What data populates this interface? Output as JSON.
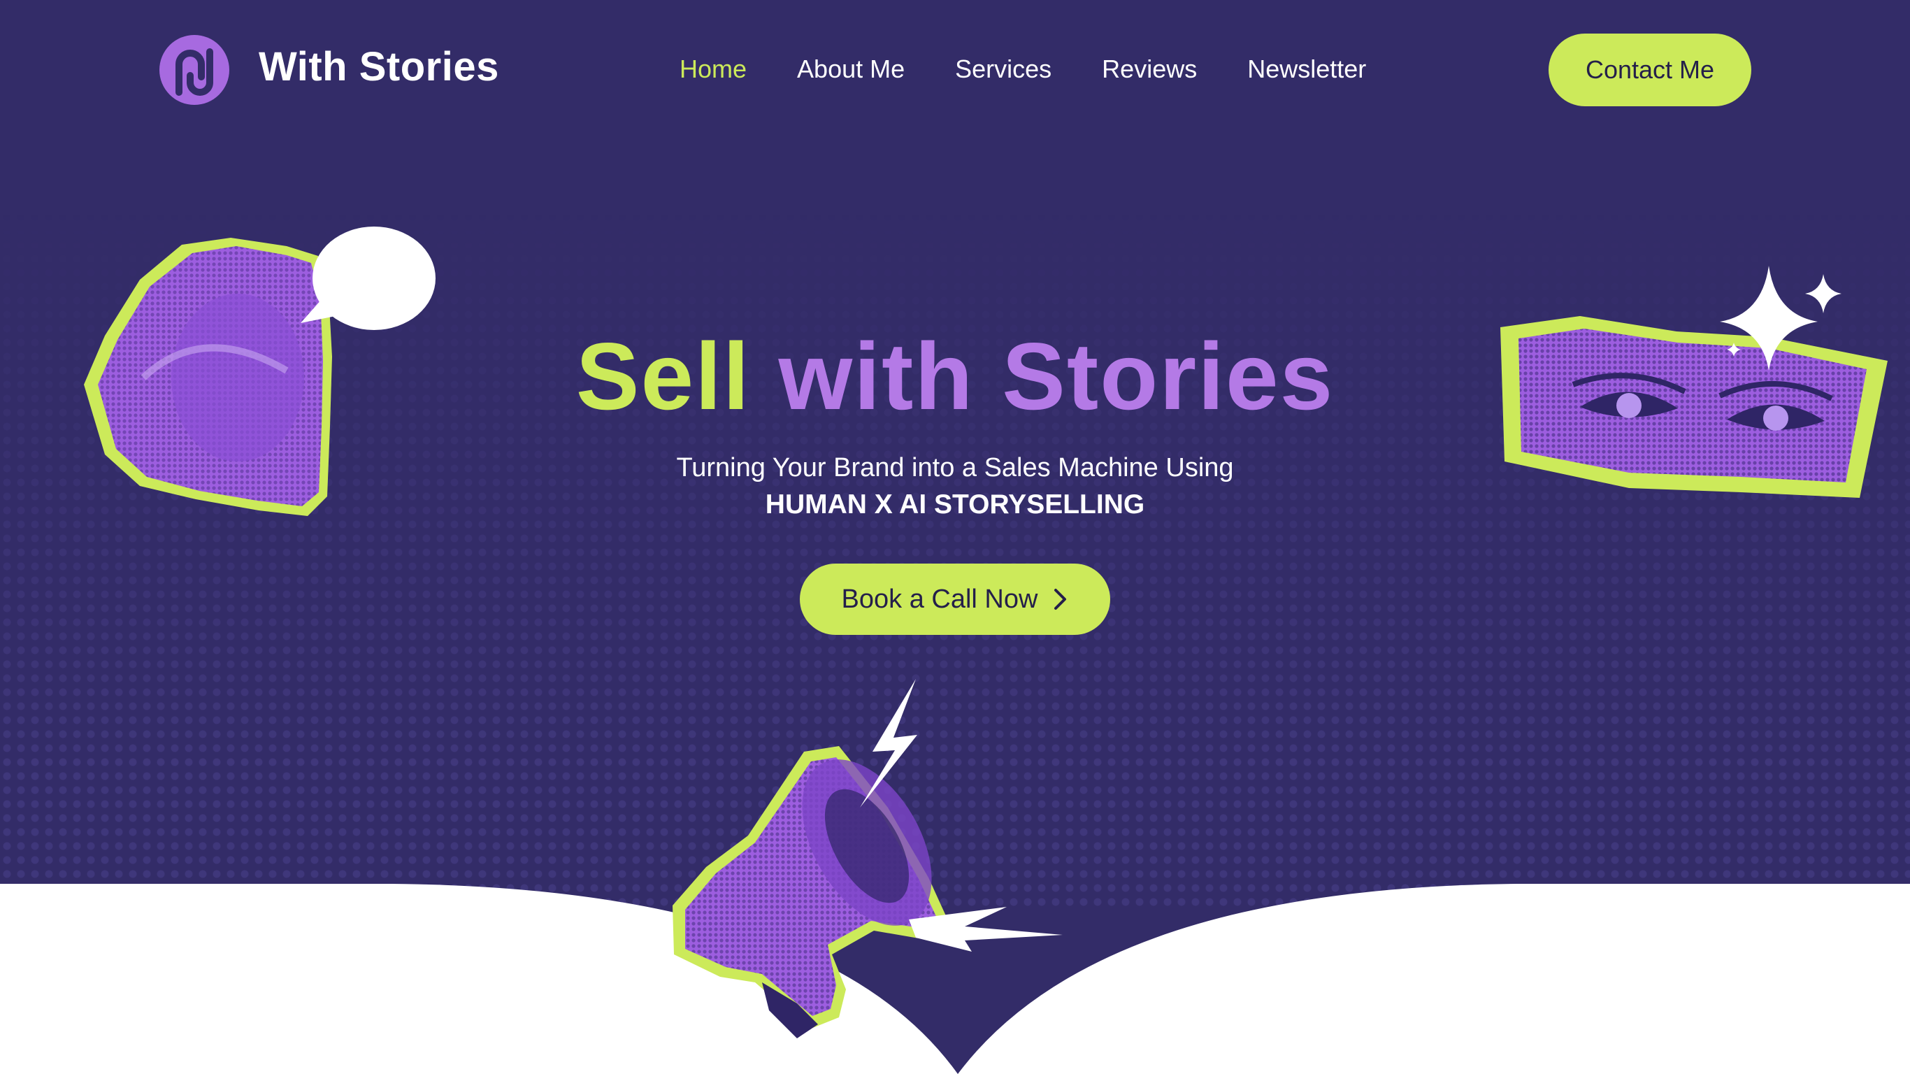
{
  "header": {
    "brand": "With Stories",
    "nav": [
      "Home",
      "About Me",
      "Services",
      "Reviews",
      "Newsletter"
    ],
    "active_nav": "Home",
    "contact_label": "Contact Me"
  },
  "hero": {
    "title_part1": "Sell",
    "title_part2": "with Stories",
    "subtitle_line1": "Turning Your Brand into a Sales Machine Using",
    "subtitle_line2": "HUMAN X AI STORYSELLING",
    "cta_label": "Book a Call Now"
  },
  "icons": {
    "logo": "logo-icon",
    "cta_arrow": "chevron-right-icon",
    "mouth": "mouth-speech-bubble-icon",
    "eyes": "eyes-collage-icon",
    "sparkle": "sparkle-icon",
    "megaphone": "megaphone-icon",
    "lightning": "lightning-icon"
  },
  "colors": {
    "background": "#332c68",
    "accent_lime": "#ccea5a",
    "accent_purple": "#b47ae6",
    "text": "#ffffff",
    "button_text": "#241f4a"
  }
}
